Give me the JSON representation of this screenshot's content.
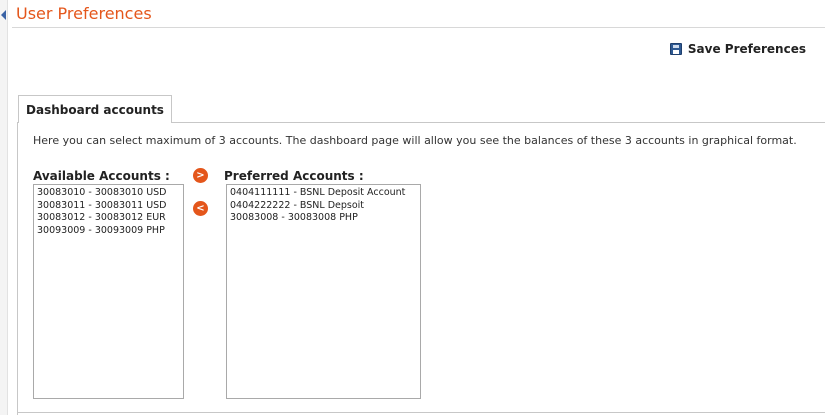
{
  "page": {
    "title": "User Preferences"
  },
  "toolbar": {
    "save_label": "Save Preferences",
    "save_icon": "floppy-disk-icon"
  },
  "tabs": [
    {
      "label": "Dashboard accounts",
      "active": true
    }
  ],
  "dashboard": {
    "description": "Here you can select maximum of 3 accounts. The dashboard page will allow you see the balances of these 3 accounts in graphical format.",
    "available": {
      "label": "Available Accounts :",
      "items": [
        "30083010 - 30083010 USD",
        "30083011 - 30083011 USD",
        "30083012 - 30083012 EUR",
        "30093009 - 30093009 PHP"
      ]
    },
    "preferred": {
      "label": "Preferred Accounts :",
      "items": [
        "0404111111 - BSNL Deposit Account",
        "0404222222 - BSNL Depsoit",
        "30083008 - 30083008 PHP"
      ]
    },
    "move_right_glyph": ">",
    "move_left_glyph": "<"
  },
  "colors": {
    "accent": "#e4561b",
    "text": "#333333",
    "border": "#c7c7c7",
    "link_blue": "#3b63a6"
  }
}
